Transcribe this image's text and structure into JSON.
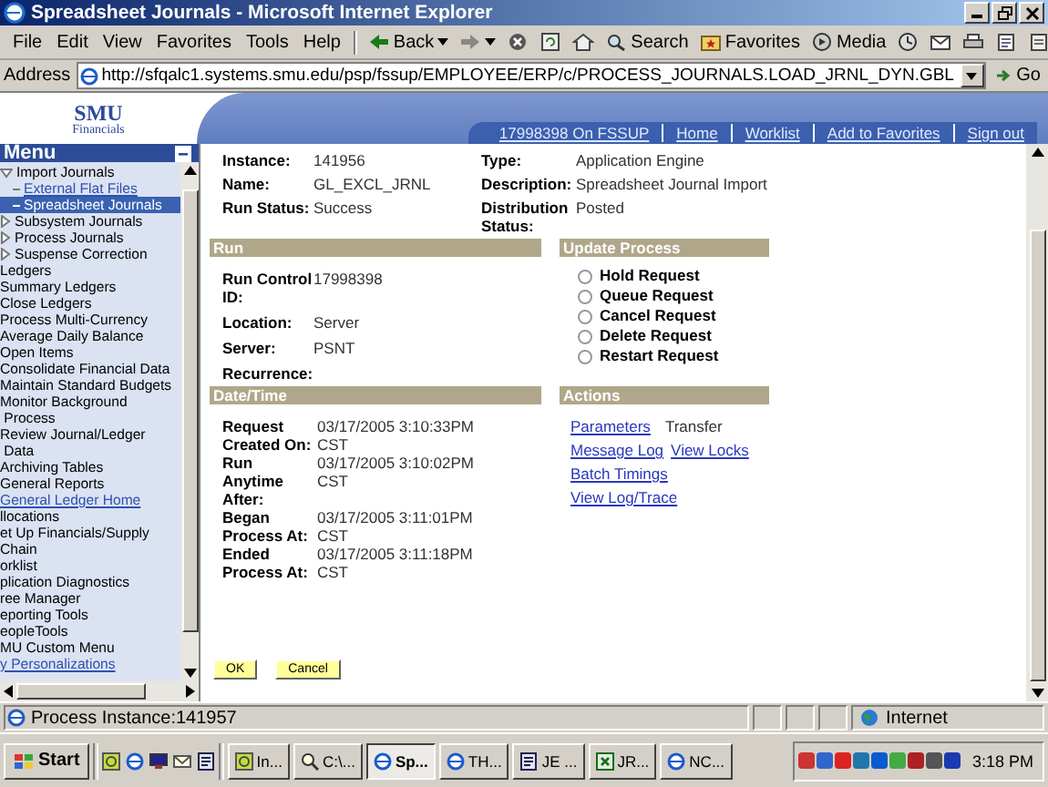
{
  "window": {
    "title": "Spreadsheet Journals - Microsoft Internet Explorer"
  },
  "menu_bar": [
    "File",
    "Edit",
    "View",
    "Favorites",
    "Tools",
    "Help"
  ],
  "toolbar": [
    {
      "kind": "back",
      "label": "Back"
    },
    {
      "kind": "forward"
    },
    {
      "kind": "stop"
    },
    {
      "kind": "refresh"
    },
    {
      "kind": "home"
    },
    {
      "kind": "search",
      "label": "Search"
    },
    {
      "kind": "favorites",
      "label": "Favorites"
    },
    {
      "kind": "media",
      "label": "Media"
    },
    {
      "kind": "history"
    },
    {
      "kind": "mail"
    },
    {
      "kind": "print"
    },
    {
      "kind": "edit"
    },
    {
      "kind": "discuss"
    }
  ],
  "address_bar": {
    "label": "Address",
    "value": "http://sfqalc1.systems.smu.edu/psp/fssup/EMPLOYEE/ERP/c/PROCESS_JOURNALS.LOAD_JRNL_DYN.GBL",
    "go": "Go"
  },
  "header": {
    "logo_title": "SMU",
    "logo_subtitle": "Financials",
    "links": [
      "17998398 On FSSUP",
      "Home",
      "Worklist",
      "Add to Favorites",
      "Sign out"
    ]
  },
  "sidebar": {
    "title": "Menu",
    "items": [
      {
        "kind": "folder",
        "label": "Import Journals",
        "expanded": true,
        "selected": false,
        "children": [
          {
            "kind": "link",
            "label": "External Flat Files",
            "selected": false
          },
          {
            "kind": "link",
            "label": "Spreadsheet Journals",
            "selected": true
          }
        ]
      },
      {
        "kind": "folder",
        "label": "Subsystem Journals",
        "expanded": false,
        "selected": false
      },
      {
        "kind": "folder",
        "label": "Process Journals",
        "expanded": false,
        "selected": false
      },
      {
        "kind": "folder",
        "label": "Suspense Correction",
        "expanded": false,
        "selected": false
      },
      {
        "kind": "item",
        "label": "Ledgers",
        "selected": false
      },
      {
        "kind": "item",
        "label": "Summary Ledgers",
        "selected": false
      },
      {
        "kind": "item",
        "label": "Close Ledgers",
        "selected": false
      },
      {
        "kind": "item",
        "label": "Process Multi-Currency",
        "selected": false
      },
      {
        "kind": "item",
        "label": "Average Daily Balance",
        "selected": false
      },
      {
        "kind": "item",
        "label": "Open Items",
        "selected": false
      },
      {
        "kind": "item",
        "label": "Consolidate Financial Data",
        "selected": false
      },
      {
        "kind": "item",
        "label": "Maintain Standard Budgets",
        "selected": false
      },
      {
        "kind": "item",
        "label": "Monitor Background\n Process",
        "selected": false
      },
      {
        "kind": "item",
        "label": "Review Journal/Ledger\n Data",
        "selected": false
      },
      {
        "kind": "item",
        "label": "Archiving Tables",
        "selected": false
      },
      {
        "kind": "item",
        "label": "General Reports",
        "selected": false
      },
      {
        "kind": "link",
        "label": "General Ledger Home",
        "selected": false
      },
      {
        "kind": "item",
        "label": "llocations",
        "selected": false
      },
      {
        "kind": "item",
        "label": "et Up Financials/Supply\nChain",
        "selected": false
      },
      {
        "kind": "item",
        "label": "orklist",
        "selected": false
      },
      {
        "kind": "item",
        "label": "plication Diagnostics",
        "selected": false
      },
      {
        "kind": "item",
        "label": "ree Manager",
        "selected": false
      },
      {
        "kind": "item",
        "label": "eporting Tools",
        "selected": false
      },
      {
        "kind": "item",
        "label": "eopleTools",
        "selected": false
      },
      {
        "kind": "item",
        "label": "MU Custom Menu",
        "selected": false
      },
      {
        "kind": "link",
        "label": "y Personalizations",
        "selected": false
      }
    ]
  },
  "summary": [
    {
      "label": "Instance:",
      "value": "141956"
    },
    {
      "label": "Type:",
      "value": "Application Engine"
    },
    {
      "label": "Name:",
      "value": "GL_EXCL_JRNL"
    },
    {
      "label": "Description:",
      "value": "Spreadsheet Journal Import"
    },
    {
      "label": "Run Status:",
      "value": "Success"
    },
    {
      "label": "Distribution Status:",
      "value": "Posted"
    }
  ],
  "run": {
    "title": "Run",
    "fields": [
      {
        "label": "Run Control ID:",
        "value": "17998398"
      },
      {
        "label": "Location:",
        "value": "Server"
      },
      {
        "label": "Server:",
        "value": "PSNT"
      },
      {
        "label": "Recurrence:"
      }
    ]
  },
  "update_process": {
    "title": "Update Process",
    "options": [
      {
        "label": "Hold Request",
        "checked": false
      },
      {
        "label": "Queue Request",
        "checked": false
      },
      {
        "label": "Cancel Request",
        "checked": false
      },
      {
        "label": "Delete Request",
        "checked": false
      },
      {
        "label": "Restart Request",
        "checked": false
      }
    ]
  },
  "date_time": {
    "title": "Date/Time",
    "fields": [
      {
        "label": "Request Created On:",
        "value": "03/17/2005  3:10:33PM CST"
      },
      {
        "label": "Run Anytime After:",
        "value": "03/17/2005  3:10:02PM CST"
      },
      {
        "label": "Began Process At:",
        "value": "03/17/2005  3:11:01PM CST"
      },
      {
        "label": "Ended Process At:",
        "value": "03/17/2005  3:11:18PM CST"
      }
    ]
  },
  "actions": {
    "title": "Actions",
    "rows": [
      [
        {
          "kind": "link",
          "label": "Parameters"
        },
        {
          "kind": "text",
          "label": "Transfer"
        }
      ],
      [
        {
          "kind": "link",
          "label": "Message Log"
        },
        {
          "kind": "link",
          "label": "View Locks"
        }
      ],
      [
        {
          "kind": "link",
          "label": "Batch Timings"
        }
      ],
      [
        {
          "kind": "link",
          "label": "View Log/Trace"
        }
      ]
    ]
  },
  "buttons": [
    "OK",
    "Cancel"
  ],
  "status_bar": {
    "text": "Process Instance:141957",
    "zone": "Internet"
  },
  "taskbar": {
    "start": "Start",
    "tasks": [
      {
        "label": "In...",
        "selected": false
      },
      {
        "label": "C:\\...",
        "selected": false
      },
      {
        "label": "Sp...",
        "selected": true
      },
      {
        "label": "TH...",
        "selected": false
      },
      {
        "label": "JE ...",
        "selected": false
      },
      {
        "label": "JR...",
        "selected": false
      },
      {
        "label": "NC...",
        "selected": false
      }
    ],
    "clock": "3:18 PM"
  }
}
